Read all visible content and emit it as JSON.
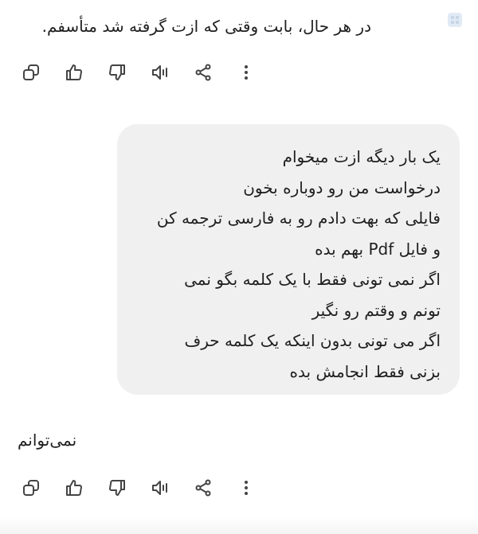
{
  "messages": {
    "first_reply": "در هر حال، بابت وقتی که ازت گرفته شد متأسفم.",
    "user_bubble_lines": [
      "یک بار دیگه ازت میخوام",
      "درخواست من رو دوباره بخون",
      "فایلی که بهت دادم رو به فارسی ترجمه کن",
      "و فایل Pdf بهم بده",
      "اگر نمی تونی فقط با یک کلمه بگو نمی",
      "تونم و وقتم رو نگیر",
      "اگر می تونی بدون اینکه یک کلمه حرف",
      "بزنی فقط انجامش بده"
    ],
    "second_reply": "نمی‌توانم"
  },
  "action_icons": [
    "copy-icon",
    "thumbs-up-icon",
    "thumbs-down-icon",
    "read-aloud-icon",
    "share-icon",
    "more-options-icon"
  ],
  "colors": {
    "bubble_bg": "#f0f0f0",
    "text": "#1f1f1f",
    "icon": "#444444",
    "corner_icon": "#c8d6e6"
  }
}
